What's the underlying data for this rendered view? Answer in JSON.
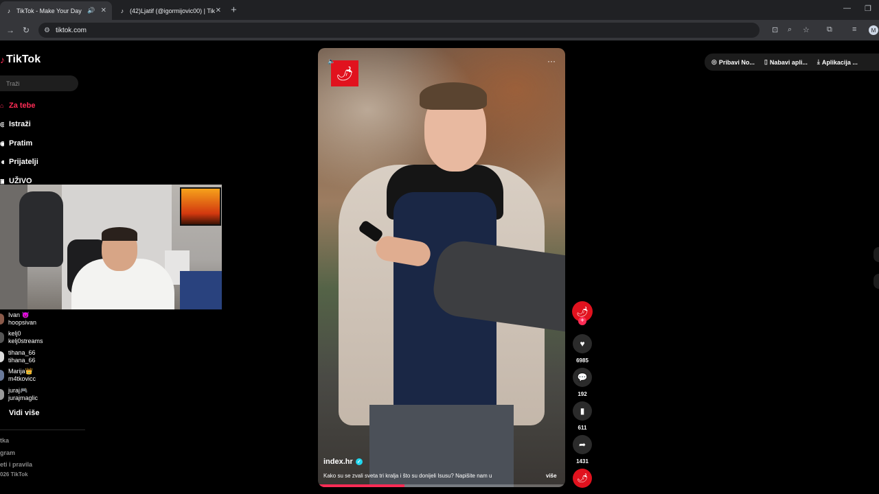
{
  "browser": {
    "tabs": [
      {
        "title": "TikTok - Make Your Day",
        "active": true
      },
      {
        "title": "(42)Ljatif (@igormijovic00) | Tik",
        "active": false
      }
    ],
    "address": "tiktok.com",
    "profile_initial": "M"
  },
  "sidebar": {
    "logo_text": "TikTok",
    "search_placeholder": "Traži",
    "nav": [
      {
        "label": "Za tebe",
        "icon": "home-icon",
        "active": true
      },
      {
        "label": "Istraži",
        "icon": "compass-icon",
        "active": false
      },
      {
        "label": "Pratim",
        "icon": "following-icon",
        "active": false
      },
      {
        "label": "Prijatelji",
        "icon": "friends-icon",
        "active": false
      },
      {
        "label": "UŽIVO",
        "icon": "live-icon",
        "active": false
      }
    ],
    "following": [
      {
        "display": "Ivan 😈",
        "handle": "hoopsivan"
      },
      {
        "display": "kelj0",
        "handle": "kelj0streams"
      },
      {
        "display": "tihana_66",
        "handle": "tihana_66"
      },
      {
        "display": "Marija👑",
        "handle": "m4tkovicc"
      },
      {
        "display": "juraj🎮",
        "handle": "jurajmaglic"
      }
    ],
    "see_more": "Vidi više",
    "footer": [
      "tka",
      "gram",
      "eti i pravila",
      "026 TikTok"
    ]
  },
  "topbar": {
    "items": [
      {
        "label": "Pribavi No...",
        "icon": "coin-icon"
      },
      {
        "label": "Nabavi apli...",
        "icon": "phone-icon"
      },
      {
        "label": "Aplikacija ...",
        "icon": "download-icon"
      }
    ]
  },
  "video": {
    "author": "index.hr",
    "description": "Kako su se zvali sveta tri kralja i što su donijeli Isusu? Napišite nam u",
    "more_label": "više",
    "progress": 0.35
  },
  "actions": {
    "likes": "6985",
    "comments": "192",
    "saves": "611",
    "shares": "1431"
  }
}
